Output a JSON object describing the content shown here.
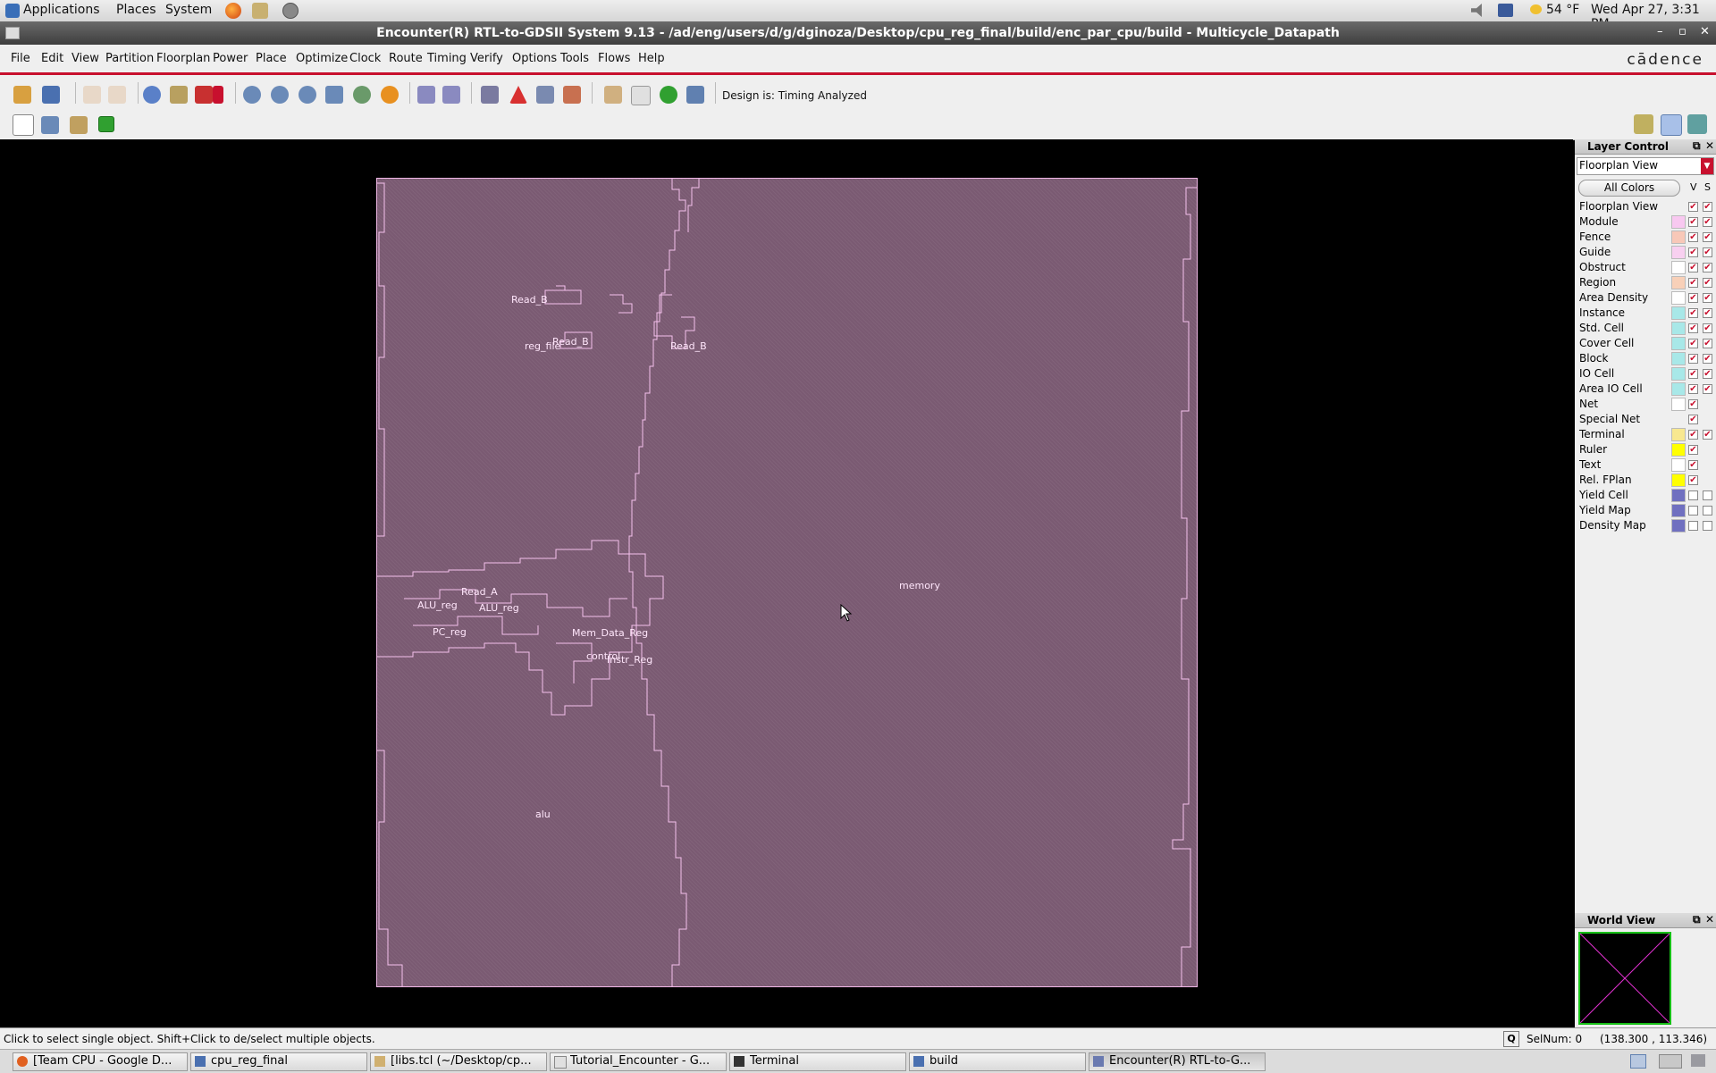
{
  "top_panel": {
    "menus": [
      "Applications",
      "Places",
      "System"
    ],
    "weather": "54 °F",
    "datetime": "Wed Apr 27,  3:31 PM"
  },
  "window": {
    "title": "Encounter(R) RTL-to-GDSII System 9.13 - /ad/eng/users/d/g/dginoza/Desktop/cpu_reg_final/build/enc_par_cpu/build - Multicycle_Datapath",
    "controls": [
      "–",
      "▫",
      "✕"
    ]
  },
  "menubar": {
    "items": [
      "File",
      "Edit",
      "View",
      "Partition",
      "Floorplan",
      "Power",
      "Place",
      "Optimize",
      "Clock",
      "Route",
      "Timing",
      "Verify",
      "Options",
      "Tools",
      "Flows",
      "Help"
    ],
    "logo": "cādence"
  },
  "toolbar": {
    "design_status": "Design is: Timing Analyzed"
  },
  "canvas": {
    "instance_labels": [
      "Read_B",
      "Read_B",
      "reg_file",
      "Read_B",
      "Read_A",
      "ALU_reg",
      "ALU_reg",
      "PC_reg",
      "Mem_Data_Reg",
      "control",
      "Instr_Reg",
      "memory",
      "alu"
    ]
  },
  "layer_control": {
    "title": "Layer Control",
    "view_select": "Floorplan View",
    "all_colors": "All Colors",
    "col_v": "V",
    "col_s": "S",
    "layers": [
      {
        "name": "Floorplan View",
        "color": "",
        "v": true,
        "s": true
      },
      {
        "name": "Module",
        "color": "#f8c8f0",
        "v": true,
        "s": true
      },
      {
        "name": "Fence",
        "color": "#f8c8b8",
        "v": true,
        "s": true
      },
      {
        "name": "Guide",
        "color": "#f8d0f0",
        "v": true,
        "s": true
      },
      {
        "name": "Obstruct",
        "color": "#ffffff",
        "v": true,
        "s": true
      },
      {
        "name": "Region",
        "color": "#f8d0b8",
        "v": true,
        "s": true
      },
      {
        "name": "Area Density",
        "color": "#ffffff",
        "v": true,
        "s": true
      },
      {
        "name": "Instance",
        "color": "#a8e8e8",
        "v": true,
        "s": true
      },
      {
        "name": "Std. Cell",
        "color": "#a8e8e8",
        "v": true,
        "s": true
      },
      {
        "name": "Cover Cell",
        "color": "#a8e8e8",
        "v": true,
        "s": true
      },
      {
        "name": "Block",
        "color": "#a8e8e8",
        "v": true,
        "s": true
      },
      {
        "name": "IO Cell",
        "color": "#a8e8e8",
        "v": true,
        "s": true
      },
      {
        "name": "Area IO Cell",
        "color": "#a8e8e8",
        "v": true,
        "s": true
      },
      {
        "name": "Net",
        "color": "#ffffff",
        "v": true,
        "s": false
      },
      {
        "name": "Special Net",
        "color": "",
        "v": true,
        "s": false
      },
      {
        "name": "Terminal",
        "color": "#f8e890",
        "v": true,
        "s": true
      },
      {
        "name": "Ruler",
        "color": "#ffff00",
        "v": true,
        "s": false
      },
      {
        "name": "Text",
        "color": "#ffffff",
        "v": true,
        "s": false
      },
      {
        "name": "Rel. FPlan",
        "color": "#ffff00",
        "v": true,
        "s": false
      },
      {
        "name": "Yield Cell",
        "color": "#7070c0",
        "v": false,
        "s": false
      },
      {
        "name": "Yield Map",
        "color": "#7070c0",
        "v": false,
        "s": false
      },
      {
        "name": "Density Map",
        "color": "#7070c0",
        "v": false,
        "s": false
      }
    ]
  },
  "world_view": {
    "title": "World View"
  },
  "statusbar": {
    "hint": "Click to select single object. Shift+Click to de/select multiple objects.",
    "q_label": "Q",
    "selnum": "SelNum: 0",
    "coords": "(138.300 , 113.346)"
  },
  "taskbar": {
    "tasks": [
      "[Team CPU - Google D...",
      "cpu_reg_final",
      "[libs.tcl (~/Desktop/cp...",
      "Tutorial_Encounter - G...",
      "Terminal",
      "build",
      "Encounter(R) RTL-to-G..."
    ]
  }
}
